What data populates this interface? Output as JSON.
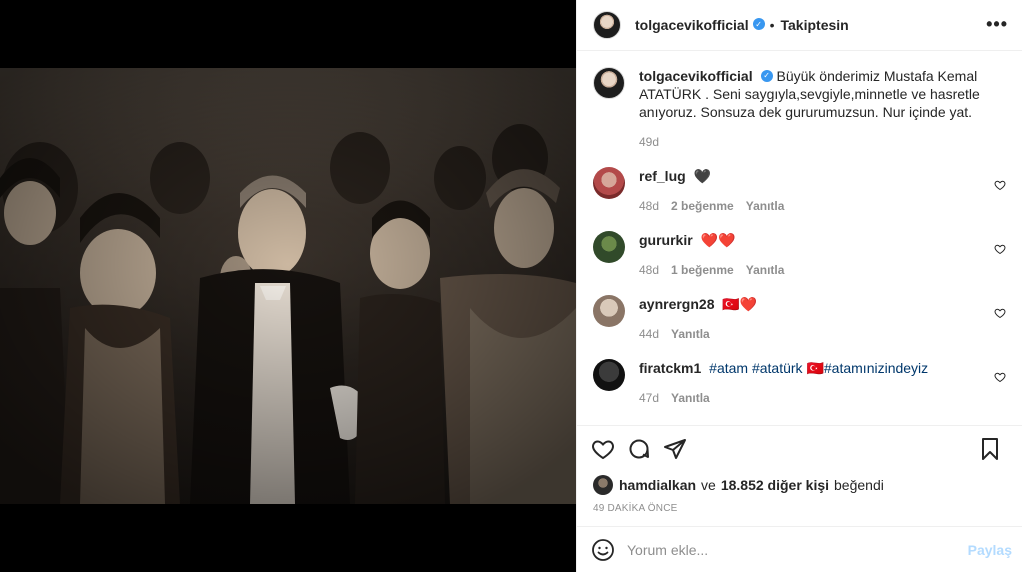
{
  "header": {
    "username": "tolgacevikofficial",
    "verified_badge": "✓",
    "separator": "•",
    "follow_status": "Takiptesin",
    "more_icon": "more-icon"
  },
  "caption": {
    "username": "tolgacevikofficial",
    "text": "Büyük önderimiz Mustafa Kemal ATATÜRK . Seni saygıyla,sevgiyle,minnetle ve hasretle anıyoruz. Sonsuza dek gururumuzsun. Nur içinde yat.",
    "time": "49d"
  },
  "comments": [
    {
      "username": "ref_lug",
      "text": "🖤",
      "time": "48d",
      "likes": "2 beğenme",
      "reply": "Yanıtla"
    },
    {
      "username": "gururkir",
      "text": "❤️❤️",
      "time": "48d",
      "likes": "1 beğenme",
      "reply": "Yanıtla"
    },
    {
      "username": "aynrergn28",
      "text": "🇹🇷❤️",
      "time": "44d",
      "likes": "",
      "reply": "Yanıtla"
    },
    {
      "username": "firatckm1",
      "text_parts": [
        "#atam",
        " ",
        "#atatürk",
        " 🇹🇷",
        "#atamınizindeyiz"
      ],
      "time": "47d",
      "likes": "",
      "reply": "Yanıtla"
    }
  ],
  "likes": {
    "user": "hamdialkan",
    "connector": "ve",
    "count": "18.852 diğer kişi",
    "suffix": "beğendi"
  },
  "timestamp": "49 DAKİKA ÖNCE",
  "add_comment": {
    "placeholder": "Yorum ekle...",
    "post_label": "Paylaş"
  },
  "colors": {
    "link": "#00376b",
    "verified": "#3897f0",
    "muted": "#8e8e8e",
    "post_disabled": "#b3dbff"
  }
}
